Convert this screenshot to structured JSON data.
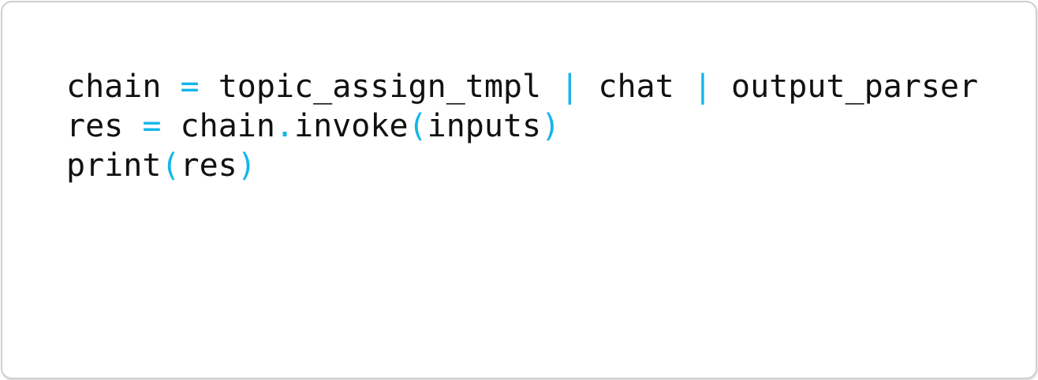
{
  "colors": {
    "operator": "#12b6ea",
    "identifier": "#111111",
    "border": "#cfcfcf",
    "background": "#ffffff"
  },
  "code": {
    "language": "python",
    "lines": [
      [
        {
          "text": "chain",
          "kind": "id"
        },
        {
          "text": " ",
          "kind": "ws"
        },
        {
          "text": "=",
          "kind": "op"
        },
        {
          "text": " ",
          "kind": "ws"
        },
        {
          "text": "topic_assign_tmpl",
          "kind": "id"
        },
        {
          "text": " ",
          "kind": "ws"
        },
        {
          "text": "|",
          "kind": "op"
        },
        {
          "text": " ",
          "kind": "ws"
        },
        {
          "text": "chat",
          "kind": "id"
        },
        {
          "text": " ",
          "kind": "ws"
        },
        {
          "text": "|",
          "kind": "op"
        },
        {
          "text": " ",
          "kind": "ws"
        },
        {
          "text": "output_parser",
          "kind": "id"
        }
      ],
      [
        {
          "text": "res",
          "kind": "id"
        },
        {
          "text": " ",
          "kind": "ws"
        },
        {
          "text": "=",
          "kind": "op"
        },
        {
          "text": " ",
          "kind": "ws"
        },
        {
          "text": "chain",
          "kind": "id"
        },
        {
          "text": ".",
          "kind": "op"
        },
        {
          "text": "invoke",
          "kind": "id"
        },
        {
          "text": "(",
          "kind": "op"
        },
        {
          "text": "inputs",
          "kind": "id"
        },
        {
          "text": ")",
          "kind": "op"
        }
      ],
      [
        {
          "text": "print",
          "kind": "id"
        },
        {
          "text": "(",
          "kind": "op"
        },
        {
          "text": "res",
          "kind": "id"
        },
        {
          "text": ")",
          "kind": "op"
        }
      ]
    ]
  }
}
